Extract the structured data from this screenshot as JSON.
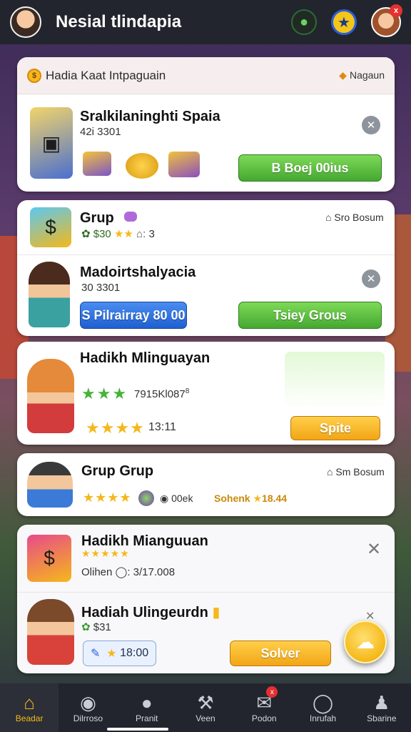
{
  "header": {
    "app_title": "Nesial tlindapia",
    "icons": [
      "avatar",
      "globe-icon",
      "star-badge-icon",
      "profile-avatar"
    ],
    "notification_badge": "x"
  },
  "hadiah_card": {
    "strip_title": "Hadia Kaat Intpaguain",
    "strip_right": "Nagaun",
    "item_title": "Sralkilaninghti Spaia",
    "item_sub": "42i 3301",
    "button_label": "B Boej 00ius"
  },
  "group_card": {
    "title": "Grup",
    "meta": "$30",
    "meta_suffix": "3",
    "right_label": "Sro Bosum",
    "second_title": "Madoirtshalyacia",
    "second_sub": "30 3301",
    "blue_button": "S Pilrairray 80 00",
    "green_button": "Tsiey Grous"
  },
  "event_card": {
    "title": "Hadikh Mlinguayan",
    "code": "7915Kl087",
    "code_sup": "8",
    "time": "13:11",
    "button_label": "Spite"
  },
  "group2_card": {
    "title": "Grup Grup",
    "right_label": "Sm Bosum",
    "meta_code": "00ek",
    "meta_link": "Sohenk",
    "meta_value": "18.44"
  },
  "reward_card": {
    "title": "Hadikh Mianguuan",
    "sub": "Olihen",
    "sub_value": "3/17.008",
    "second_title": "Hadiah Ulingeurdn",
    "second_sub": "$31",
    "pill_value": "18:00",
    "button_label": "Solver"
  },
  "bottom_nav": {
    "items": [
      {
        "label": "Beadar",
        "icon": "home-icon"
      },
      {
        "label": "Dilrroso",
        "icon": "chat-icon"
      },
      {
        "label": "Pranit",
        "icon": "ghost-icon"
      },
      {
        "label": "Veen",
        "icon": "hammer-icon"
      },
      {
        "label": "Podon",
        "icon": "mail-icon",
        "badge": "x"
      },
      {
        "label": "Inrufah",
        "icon": "chat-bubble-icon"
      },
      {
        "label": "Sbarine",
        "icon": "person-icon"
      }
    ]
  },
  "colors": {
    "bar": "#22252d",
    "green": "#45a831",
    "blue": "#1f5fd0",
    "orange": "#f2a516",
    "star": "#f5b81a"
  }
}
